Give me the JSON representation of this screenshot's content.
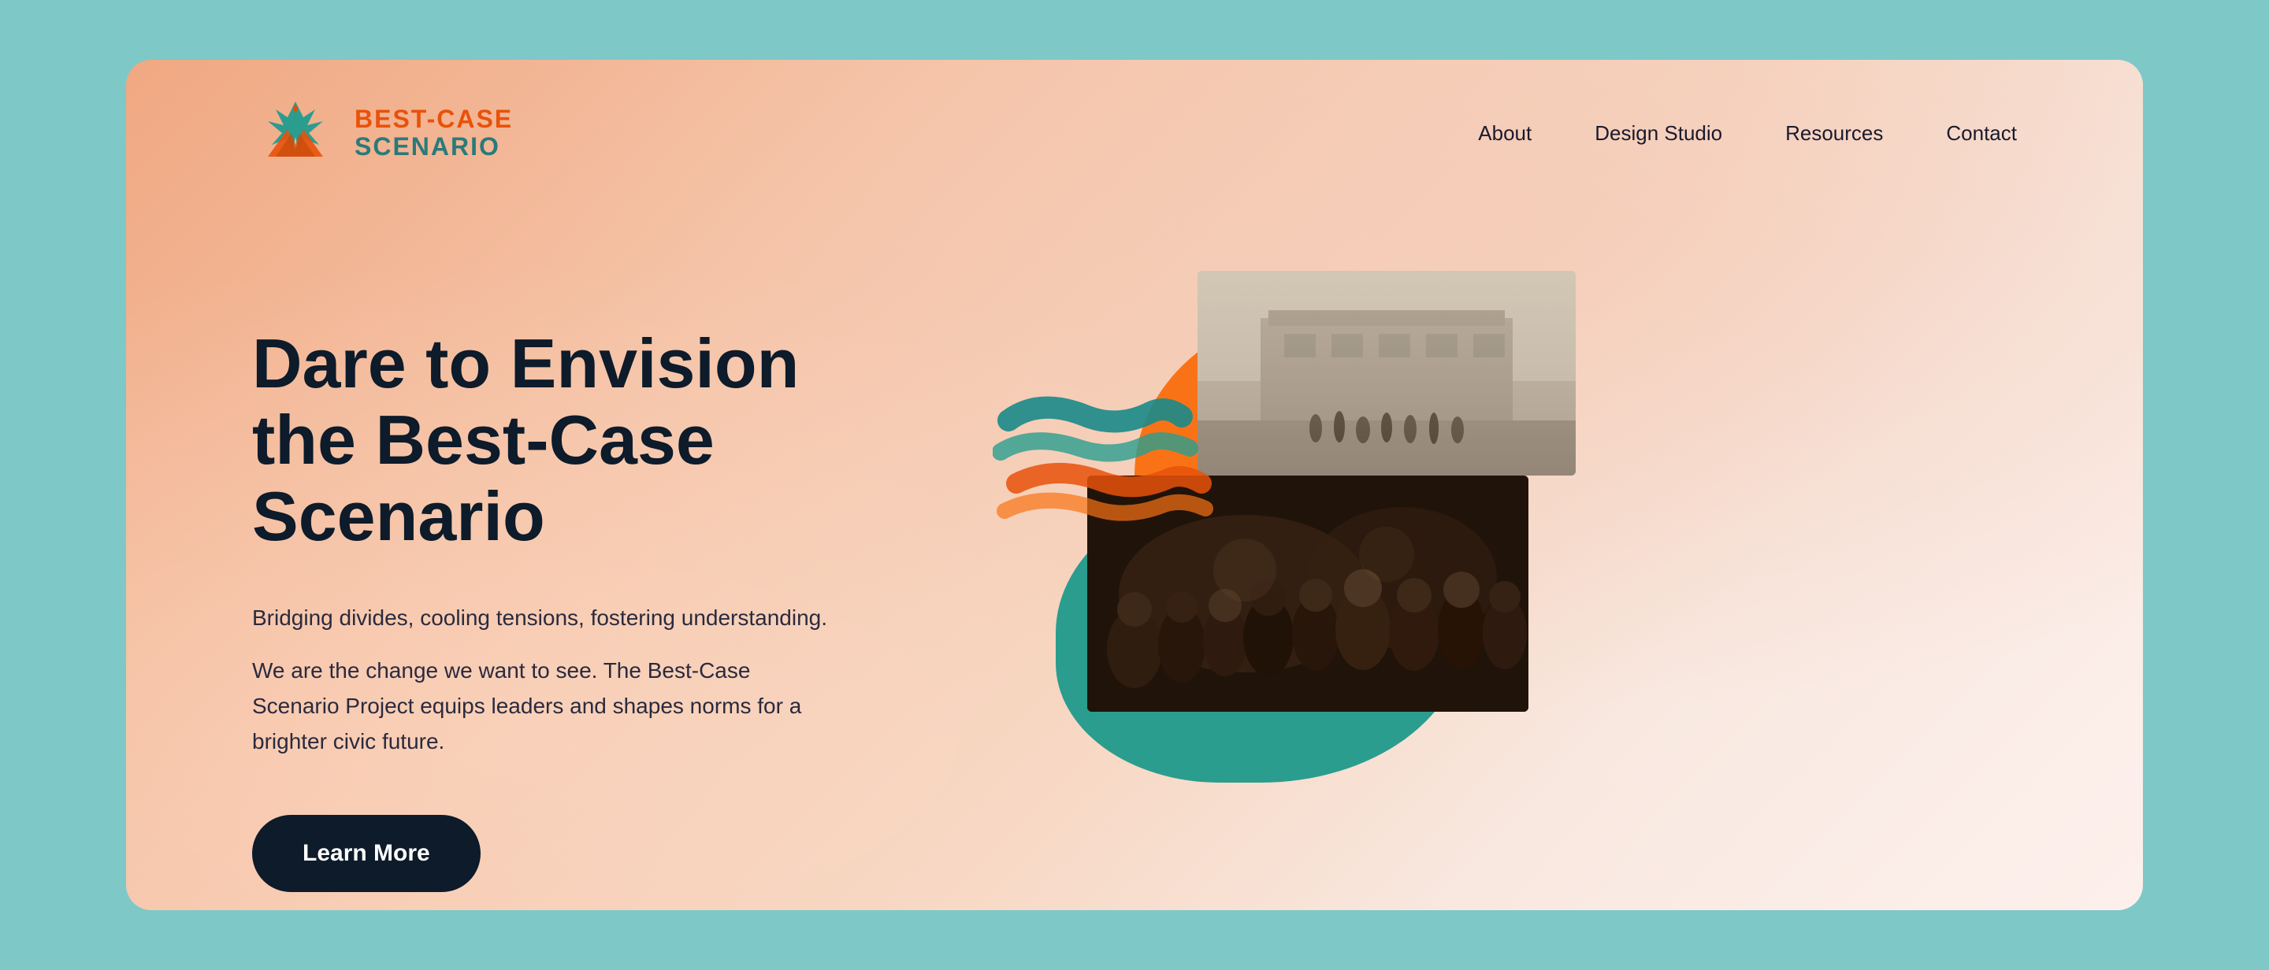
{
  "page": {
    "title": "Best-Case Scenario"
  },
  "logo": {
    "line1_best": "BEST-",
    "line1_case": "CASE",
    "line2": "SCENARIO"
  },
  "nav": {
    "links": [
      {
        "label": "About",
        "href": "#about"
      },
      {
        "label": "Design Studio",
        "href": "#design-studio"
      },
      {
        "label": "Resources",
        "href": "#resources"
      },
      {
        "label": "Contact",
        "href": "#contact"
      }
    ]
  },
  "hero": {
    "title": "Dare to Envision the Best-Case Scenario",
    "subtitle": "Bridging divides, cooling tensions, fostering understanding.",
    "description": "We are the change we want to see. The Best-Case Scenario Project equips leaders and shapes norms for a brighter civic future.",
    "cta_label": "Learn More"
  },
  "colors": {
    "background_start": "#f0a882",
    "background_end": "#fdf0ec",
    "accent_orange": "#f97316",
    "accent_teal": "#2a9d8f",
    "logo_orange": "#e8520a",
    "logo_teal": "#2a7a7a",
    "title_dark": "#0d1b2a",
    "button_bg": "#0d1b2a",
    "button_text": "#ffffff",
    "nav_text": "#1a1a2e"
  }
}
